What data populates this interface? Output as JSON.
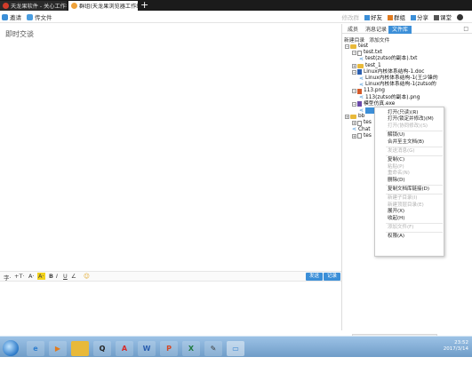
{
  "tabs": [
    {
      "label": "天龙果软件 - 关心工作者的实践",
      "active": false
    },
    {
      "label": "群组(天龙果浏览器工作组)",
      "active": true
    }
  ],
  "new_tab_label": "+",
  "toolbar": {
    "left": [
      "邀请",
      "传文件"
    ],
    "right_disabled": "修改群",
    "right": [
      "好友",
      "群组",
      "分享",
      "课堂"
    ]
  },
  "chat": {
    "title": "即时交谈"
  },
  "format_bar": {
    "items": [
      "字·",
      "+T·",
      "A·",
      "A·",
      "B",
      "I",
      "U",
      "∠",
      "☺"
    ],
    "send_label": "发送",
    "record_label": "记录"
  },
  "right_panel": {
    "tabs": [
      "成员",
      "消息记录",
      "文件库"
    ],
    "active_tab": 2,
    "close": "□",
    "actions": [
      "新建目录",
      "添加文件"
    ],
    "tree": [
      {
        "label": "test",
        "kind": "folder",
        "expander": "−",
        "indent": 0
      },
      {
        "label": "test.txt",
        "kind": "file",
        "expander": "−",
        "indent": 1
      },
      {
        "label": "test(zutso的副本).txt",
        "kind": "share",
        "expander": "",
        "indent": 2
      },
      {
        "label": "test_1",
        "kind": "folder",
        "expander": "+",
        "indent": 1
      },
      {
        "label": "Linux内核体系结构-1.doc",
        "kind": "doc",
        "expander": "−",
        "indent": 1
      },
      {
        "label": "Linux内核体系结构-1(王少锋的",
        "kind": "share",
        "expander": "",
        "indent": 2
      },
      {
        "label": "Linux内核体系结构-1(zutso的",
        "kind": "share",
        "expander": "",
        "indent": 2
      },
      {
        "label": "113.png",
        "kind": "png",
        "expander": "−",
        "indent": 1
      },
      {
        "label": "113(zutso的副本).png",
        "kind": "share",
        "expander": "",
        "indent": 2
      },
      {
        "label": "模型仿真.exe",
        "kind": "exe",
        "expander": "−",
        "indent": 1
      },
      {
        "label": "",
        "kind": "share-selected",
        "expander": "",
        "indent": 2
      },
      {
        "label": "bb",
        "kind": "folder",
        "expander": "+",
        "indent": 0
      },
      {
        "label": "tes",
        "kind": "file",
        "expander": "+",
        "indent": 1
      },
      {
        "label": "Chat",
        "kind": "share",
        "expander": "",
        "indent": 1
      },
      {
        "label": "tes",
        "kind": "file",
        "expander": "+",
        "indent": 1
      }
    ]
  },
  "context_menu": {
    "items": [
      {
        "label": "打开(只读)(R)",
        "disabled": false
      },
      {
        "label": "打开(锁定并修改)(M)",
        "disabled": false
      },
      {
        "label": "打开(协同修改)(S)",
        "disabled": true
      },
      {
        "sep": true
      },
      {
        "label": "解锁(U)",
        "disabled": false
      },
      {
        "label": "合并至主文档(B)",
        "disabled": false
      },
      {
        "sep": true
      },
      {
        "label": "发送消息(G)",
        "disabled": true
      },
      {
        "sep": true
      },
      {
        "label": "复制(C)",
        "disabled": false
      },
      {
        "label": "粘贴(P)",
        "disabled": true
      },
      {
        "label": "重命名(N)",
        "disabled": true
      },
      {
        "label": "删除(D)",
        "disabled": false
      },
      {
        "sep": true
      },
      {
        "label": "复制文档库链接(D)",
        "disabled": false
      },
      {
        "sep": true
      },
      {
        "label": "新建子目录(I)",
        "disabled": true
      },
      {
        "label": "新建顶层目录(E)",
        "disabled": true
      },
      {
        "label": "展开(X)",
        "disabled": false
      },
      {
        "label": "收起(H)",
        "disabled": false
      },
      {
        "sep": true
      },
      {
        "label": "添加文件(F)",
        "disabled": true
      },
      {
        "sep": true
      },
      {
        "label": "权限(A)",
        "disabled": false
      }
    ]
  },
  "taskbar": {
    "apps": [
      {
        "name": "ie-icon",
        "glyph": "e",
        "color": "#2f7fd0"
      },
      {
        "name": "media-player-icon",
        "glyph": "▶",
        "color": "#e07a1e"
      },
      {
        "name": "folder-icon",
        "glyph": "",
        "color": "#e8b93a"
      },
      {
        "name": "qq-icon",
        "glyph": "Q",
        "color": "#222"
      },
      {
        "name": "pdf-icon",
        "glyph": "A",
        "color": "#d62a2a"
      },
      {
        "name": "word-icon",
        "glyph": "W",
        "color": "#2b5fb0"
      },
      {
        "name": "powerpoint-icon",
        "glyph": "P",
        "color": "#d24726"
      },
      {
        "name": "excel-icon",
        "glyph": "X",
        "color": "#1f7a3f"
      },
      {
        "name": "tool-icon",
        "glyph": "✎",
        "color": "#3a3a3a"
      },
      {
        "name": "browser-icon",
        "glyph": "▭",
        "color": "#2f7fd0"
      }
    ],
    "time": "23:52",
    "date": "2017/3/14"
  }
}
